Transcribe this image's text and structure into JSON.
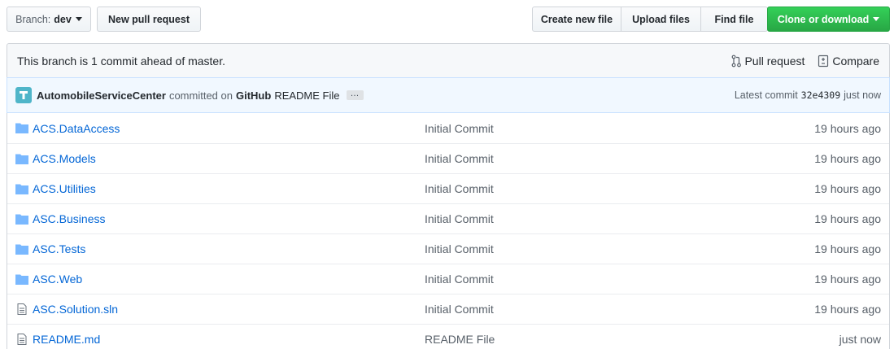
{
  "toolbar": {
    "branch_prefix": "Branch:",
    "branch_name": "dev",
    "new_pull_request": "New pull request",
    "create_new_file": "Create new file",
    "upload_files": "Upload files",
    "find_file": "Find file",
    "clone_or_download": "Clone or download",
    "clone_color": "#2cbe4e"
  },
  "branch_info": {
    "text": "This branch is 1 commit ahead of master.",
    "pull_request": "Pull request",
    "compare": "Compare"
  },
  "commit": {
    "author": "AutomobileServiceCenter",
    "committed_on": "committed on",
    "platform": "GitHub",
    "message": "README File",
    "ellipsis": "…",
    "latest_label": "Latest commit",
    "sha": "32e4309",
    "time": "just now"
  },
  "files": [
    {
      "type": "folder",
      "name": "ACS.DataAccess",
      "message": "Initial Commit",
      "age": "19 hours ago"
    },
    {
      "type": "folder",
      "name": "ACS.Models",
      "message": "Initial Commit",
      "age": "19 hours ago"
    },
    {
      "type": "folder",
      "name": "ACS.Utilities",
      "message": "Initial Commit",
      "age": "19 hours ago"
    },
    {
      "type": "folder",
      "name": "ASC.Business",
      "message": "Initial Commit",
      "age": "19 hours ago"
    },
    {
      "type": "folder",
      "name": "ASC.Tests",
      "message": "Initial Commit",
      "age": "19 hours ago"
    },
    {
      "type": "folder",
      "name": "ASC.Web",
      "message": "Initial Commit",
      "age": "19 hours ago"
    },
    {
      "type": "file",
      "name": "ASC.Solution.sln",
      "message": "Initial Commit",
      "age": "19 hours ago"
    },
    {
      "type": "file",
      "name": "README.md",
      "message": "README File",
      "age": "just now"
    }
  ]
}
